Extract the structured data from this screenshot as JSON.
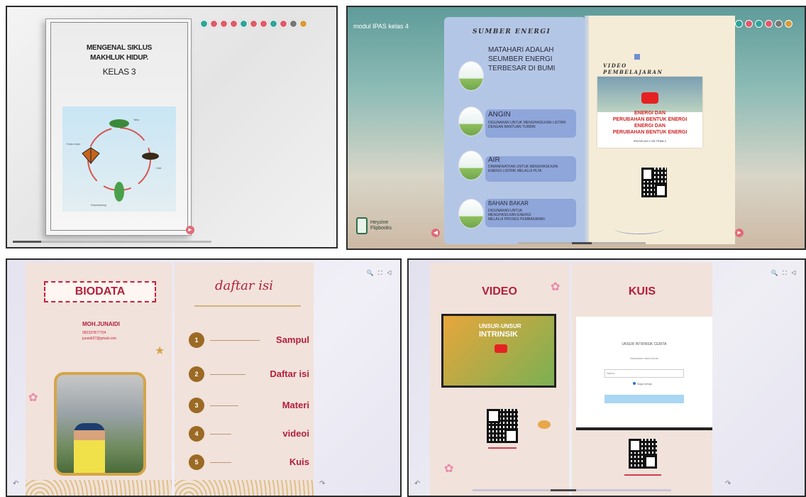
{
  "panel1": {
    "cover": {
      "title_line1": "MENGENAL SIKLUS",
      "title_line2": "MAKHLUK HIDUP.",
      "title_line3": "KELAS 3",
      "stages": [
        "Telur",
        "Ulat",
        "Kepompong",
        "Kupu-kupu"
      ]
    },
    "toolbar_colors": [
      "#2fa59a",
      "#e05a6a",
      "#e05a6a",
      "#e05a6a",
      "#2fa59a",
      "#e05a6a",
      "#e05a6a",
      "#2fa59a",
      "#e05a6a",
      "#777777",
      "#d89b3a"
    ]
  },
  "panel2": {
    "modul_label": "modul IPAS kelas 4",
    "left_heading": "SUMBER ENERGI",
    "items": [
      {
        "title": "MATAHARI ADALAH SEUMBER ENERGI TERBESAR DI BUMI",
        "desc": ""
      },
      {
        "title": "ANGIN",
        "desc": "DIGUNAKAN UNTUK MENGHASILKAN LISTRIK DENGAN BANTUAN TURBIN"
      },
      {
        "title": "AIR",
        "desc": "DIMANFAATKAN UNTUK MENGHASILKAN ENERGI LISTRIK MELALUI PLTA"
      },
      {
        "title": "BAHAN BAKAR",
        "desc": "DIGUNAKAN UNTUK MENGHASILKAN ENERGI MELALUI PROSES PEMBAKARAN"
      }
    ],
    "right_heading_1": "VIDEO",
    "right_heading_2": "PEMBELAJARAN",
    "video": {
      "line1": "ENERGI DAN",
      "line2": "PERUBAHAN BENTUK ENERGI",
      "line3": "ENERGI DAN",
      "line4": "PERUBAHAN BENTUK ENERGI",
      "caption": "IPA KELAS V SD TEMA 2"
    },
    "brand_line1": "Heyzine",
    "brand_line2": "Flipbooks",
    "toolbar_colors": [
      "#e05a6a",
      "#e05a6a",
      "#2fa59a",
      "#2fa59a",
      "#e05a6a",
      "#2fa59a",
      "#e05a6a",
      "#2fa59a",
      "#e05a6a",
      "#777777",
      "#d89b3a"
    ]
  },
  "panel3": {
    "biodata_title": "BIODATA",
    "name": "MOH.JUNAIDI",
    "phone": "082337877704",
    "email": "junaidi37@gmail.com",
    "toc_heading": "daftar isi",
    "toc": [
      {
        "num": "1",
        "label": "Sampul"
      },
      {
        "num": "2",
        "label": "Daftar isi"
      },
      {
        "num": "3",
        "label": "Materi"
      },
      {
        "num": "4",
        "label": "videoi"
      },
      {
        "num": "5",
        "label": "Kuis"
      }
    ],
    "tools": "🔍 ⛶ ◁"
  },
  "panel4": {
    "video_title": "VIDEO",
    "quiz_title": "KUIS",
    "thumb_line1": "UNSUR-UNSUR",
    "thumb_line2": "INTRINSIK",
    "form_title": "UNSUR INTRINSIK CERITA",
    "form_subtitle": "Masukkan nama Anda",
    "form_placeholder": "Nama",
    "form_radio": "Saya setuju",
    "tools": "🔍 ⛶ ◁"
  }
}
